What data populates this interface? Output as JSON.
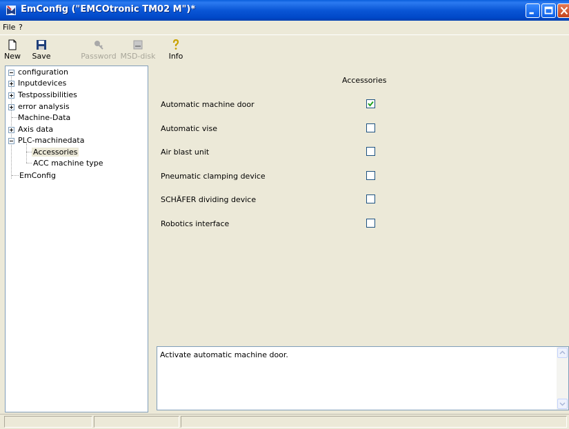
{
  "window": {
    "title": "EmConfig (\"EMCOtronic TM02 M\")*"
  },
  "menu": [
    "File",
    "?"
  ],
  "toolbar": {
    "new": {
      "label": "New",
      "icon": "new-document-icon",
      "enabled": true
    },
    "save": {
      "label": "Save",
      "icon": "floppy-disk-icon",
      "enabled": true
    },
    "password": {
      "label": "Password",
      "icon": "key-icon",
      "enabled": false
    },
    "msd": {
      "label": "MSD-disk",
      "icon": "disk-drive-icon",
      "enabled": false
    },
    "info": {
      "label": "Info",
      "icon": "question-mark-icon",
      "enabled": true
    }
  },
  "tree": [
    {
      "label": "configuration",
      "level": 0,
      "expander": "minus"
    },
    {
      "label": "Inputdevices",
      "level": 1,
      "expander": "plus"
    },
    {
      "label": "Testpossibilities",
      "level": 1,
      "expander": "plus"
    },
    {
      "label": "error analysis",
      "level": 1,
      "expander": "plus"
    },
    {
      "label": "Machine-Data",
      "level": 1,
      "expander": "none"
    },
    {
      "label": "Axis data",
      "level": 1,
      "expander": "plus"
    },
    {
      "label": "PLC-machinedata",
      "level": 1,
      "expander": "minus"
    },
    {
      "label": "Accessories",
      "level": 2,
      "expander": "none",
      "selected": true
    },
    {
      "label": "ACC machine type",
      "level": 2,
      "expander": "none"
    },
    {
      "label": "EmConfig",
      "level": 1,
      "expander": "none"
    }
  ],
  "panel": {
    "title": "Accessories",
    "options": [
      {
        "label": "Automatic machine door",
        "checked": true
      },
      {
        "label": "Automatic vise",
        "checked": false
      },
      {
        "label": "Air blast unit",
        "checked": false
      },
      {
        "label": "Pneumatic clamping device",
        "checked": false
      },
      {
        "label": "SCHÄFER dividing device",
        "checked": false
      },
      {
        "label": "Robotics interface",
        "checked": false
      }
    ]
  },
  "description": "Activate automatic machine door.",
  "colors": {
    "titlebar": "#0a56d6",
    "check": "#21a121",
    "face": "#ece9d8"
  }
}
